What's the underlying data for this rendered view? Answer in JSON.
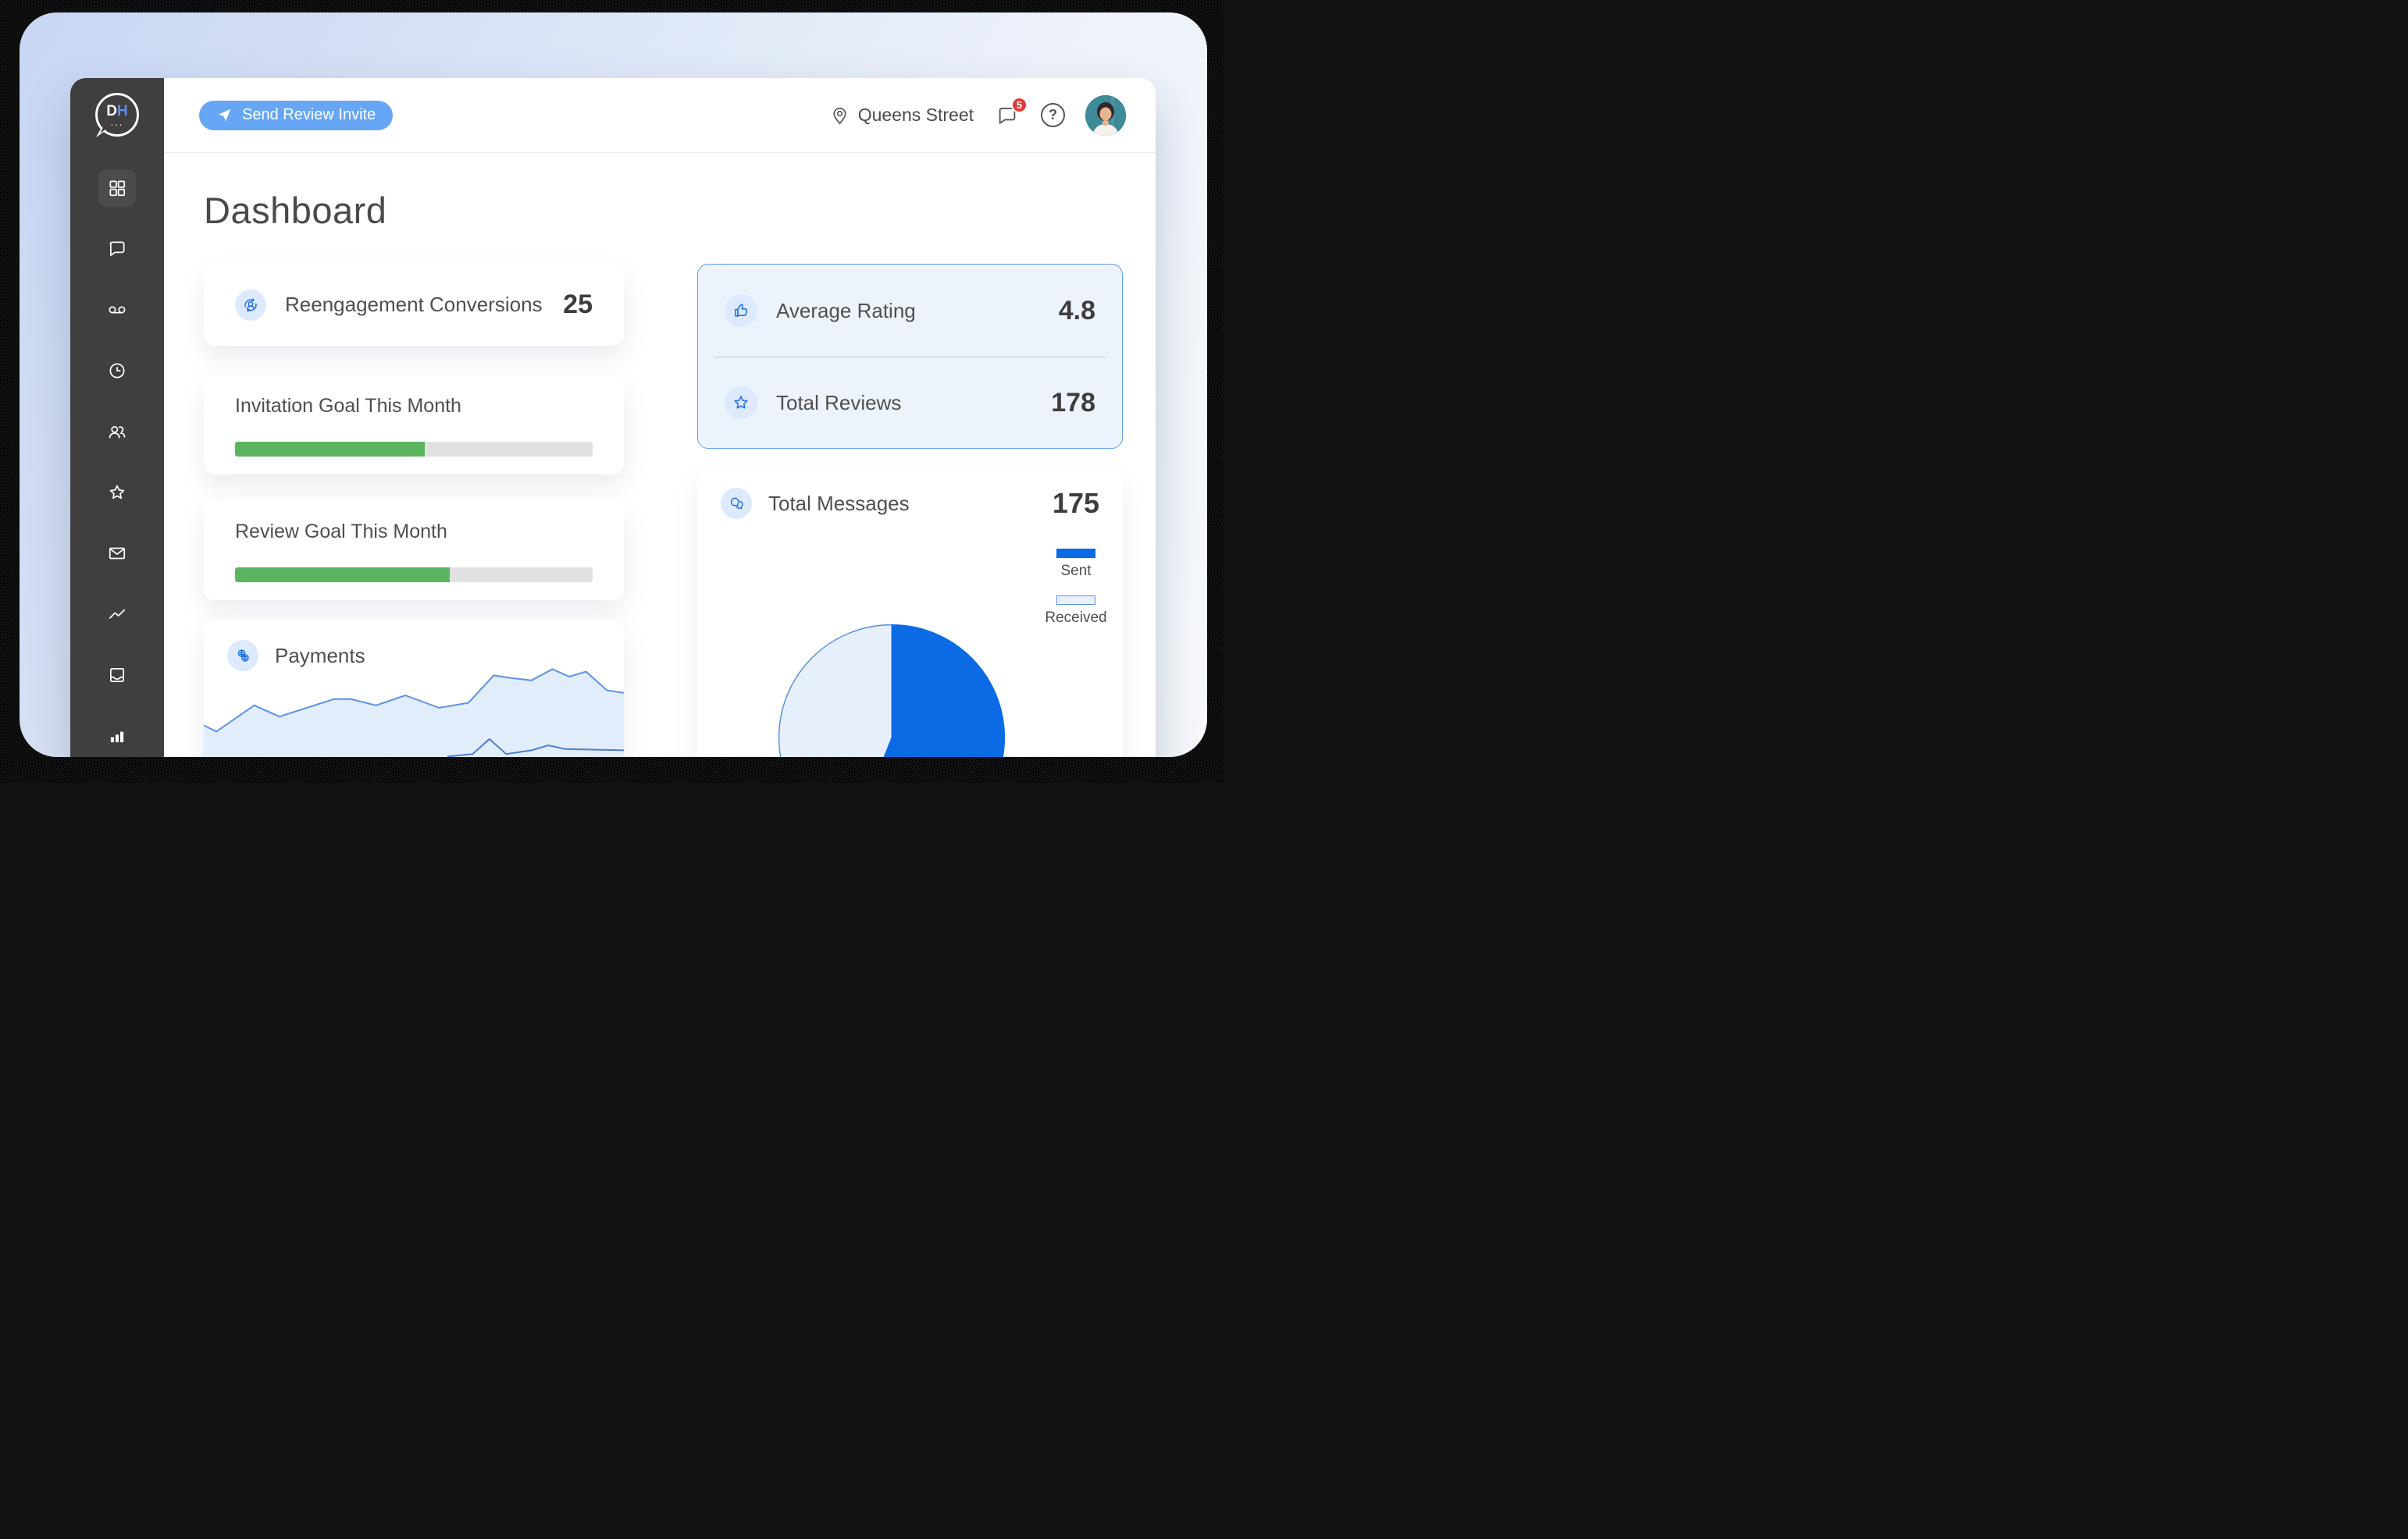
{
  "sidebar": {
    "logo": {
      "d": "D",
      "h": "H",
      "dots": "..."
    },
    "items": [
      {
        "name": "dashboard",
        "icon": "grid-icon",
        "active": true
      },
      {
        "name": "messages",
        "icon": "chat-bubble-icon",
        "active": false
      },
      {
        "name": "voicemail",
        "icon": "voicemail-icon",
        "active": false
      },
      {
        "name": "history",
        "icon": "clock-icon",
        "active": false
      },
      {
        "name": "customers",
        "icon": "users-icon",
        "active": false
      },
      {
        "name": "reviews",
        "icon": "star-icon",
        "active": false
      },
      {
        "name": "mail",
        "icon": "envelope-icon",
        "active": false
      },
      {
        "name": "trends",
        "icon": "trending-line-icon",
        "active": false
      },
      {
        "name": "inbox",
        "icon": "inbox-icon",
        "active": false
      },
      {
        "name": "analytics",
        "icon": "bar-chart-icon",
        "active": false
      }
    ]
  },
  "header": {
    "invite_button": "Send Review Invite",
    "location": "Queens Street",
    "notification_count": "5",
    "help_label": "?"
  },
  "page": {
    "title": "Dashboard"
  },
  "cards": {
    "reengagement": {
      "label": "Reengagement Conversions",
      "value": "25"
    },
    "invitation_goal": {
      "label": "Invitation Goal This Month",
      "percent": 53
    },
    "review_goal": {
      "label": "Review Goal This Month",
      "percent": 60
    },
    "payments": {
      "label": "Payments"
    },
    "rating": {
      "label": "Average Rating",
      "value": "4.8"
    },
    "reviews": {
      "label": "Total Reviews",
      "value": "178"
    },
    "messages": {
      "label": "Total Messages",
      "value": "175",
      "legend": [
        {
          "label": "Sent"
        },
        {
          "label": "Received"
        }
      ]
    }
  },
  "chart_data": [
    {
      "type": "pie",
      "title": "Total Messages",
      "total": 175,
      "slices": [
        {
          "label": "Sent",
          "percent": 56,
          "color": "#0a6be5"
        },
        {
          "label": "Received",
          "percent": 44,
          "color": "#e7effd"
        }
      ],
      "legend_position": "top-right",
      "start_angle_deg": 0,
      "direction": "clockwise"
    },
    {
      "type": "area",
      "title": "Payments",
      "y_range": [
        0,
        100
      ],
      "grid": false,
      "series": [
        {
          "name": "payments",
          "x": [
            0,
            3,
            12,
            18,
            31,
            35,
            41,
            48,
            56,
            63,
            69,
            73,
            78,
            83,
            87,
            91,
            96,
            100
          ],
          "y": [
            51,
            46,
            67,
            58,
            72,
            72,
            67,
            75,
            65,
            69,
            91,
            89,
            87,
            96,
            90,
            94,
            79,
            77
          ]
        },
        {
          "name": "secondary",
          "x": [
            58,
            64,
            68,
            72,
            78,
            82,
            86,
            100
          ],
          "y": [
            26,
            28,
            40,
            28,
            31,
            35,
            32,
            31
          ]
        }
      ]
    }
  ],
  "colors": {
    "accent_blue": "#66a6f4",
    "icon_blue": "#1a6be0",
    "pie_blue": "#0a6be5",
    "pie_light": "#e7effd",
    "green": "#5bb55f",
    "track_gray": "#e1e1e1",
    "sidebar_bg": "#403e3e",
    "badge_red": "#e23b3b",
    "area_line": "#5b92e5",
    "area_fill": "#dbe8fb"
  }
}
